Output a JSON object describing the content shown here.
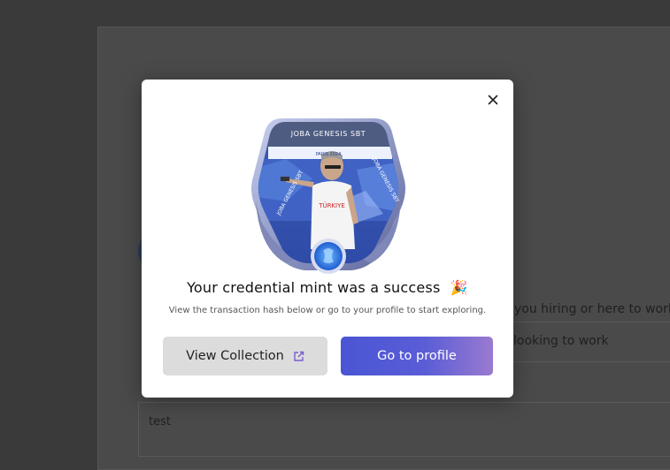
{
  "modal": {
    "title": "Your credential mint was a success",
    "title_emoji": "🎉",
    "subtitle": "View the transaction hash below or go to your profile to start exploring.",
    "view_collection_label": "View Collection",
    "go_to_profile_label": "Go to profile",
    "badge": {
      "top_label": "JOBA GENESIS SBT",
      "ring_left": "JOBA GENESIS SBT",
      "ring_right": "JOBA GENESIS SBT",
      "banner_text": "PARIS 2024",
      "shirt_text": "TÜRKIYE"
    }
  },
  "background": {
    "question": "you hiring or here to work?",
    "selected_option": "looking to work",
    "textarea_value": "test"
  },
  "colors": {
    "primary_start": "#4a55d4",
    "primary_end": "#9a7ad0",
    "secondary_bg": "#dcdcdc",
    "overlay": "#3a3a3a"
  }
}
